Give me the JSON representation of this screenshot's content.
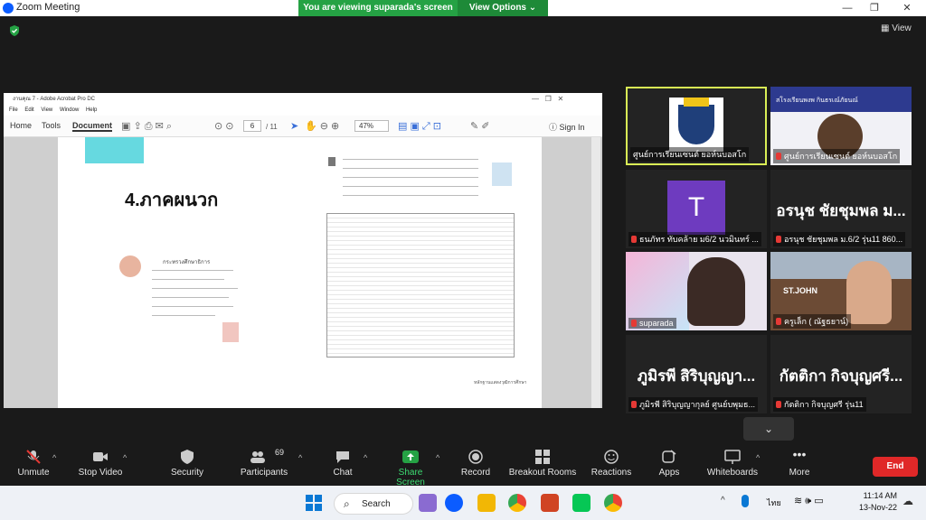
{
  "window": {
    "title": "Zoom Meeting",
    "minimize": "—",
    "maximize": "❐",
    "close": "✕"
  },
  "share_banner": {
    "text": "You are viewing suparada's screen",
    "view_options": "View Options ⌄"
  },
  "view_button": "View",
  "acrobat": {
    "title": "งานคุณ 7 - Adobe Acrobat Pro DC",
    "menu": [
      "File",
      "Edit",
      "View",
      "Window",
      "Help"
    ],
    "tabs": [
      "Home",
      "Tools",
      "Document"
    ],
    "page_current": "6",
    "page_total": "/ 11",
    "zoom": "47%",
    "sign_in": "Sign In",
    "page1_heading": "4.ภาคผนวก",
    "page1_cert_title": "กระทรวงศึกษาธิการ",
    "page2_footer": "หลักฐานแสดงวุฒิการศึกษา"
  },
  "participants": [
    {
      "name": "ศูนย์การเรียนเซนต์ ยอห์นบอสโก",
      "big": "",
      "muted": false
    },
    {
      "name": "ศูนย์การเรียนเซนต์ ยอห์นบอสโก",
      "big": "",
      "muted": true
    },
    {
      "name": "ธนภัทร ทับคล้าย ม6/2 นวมินทร์ ...",
      "big": "T",
      "muted": true
    },
    {
      "name": "อรนุช ชัยชุมพล ม.6/2 รุ่น11 860...",
      "big": "อรนุช ชัยชุมพล ม...",
      "muted": true
    },
    {
      "name": "suparada",
      "big": "",
      "muted": true
    },
    {
      "name": "ครูเล็ก ( ณัฐธยาน์)",
      "big": "",
      "muted": true
    },
    {
      "name": "ภูมิรพี สิริบุญญากุลย์ ศูนย์บพุมธ...",
      "big": "ภูมิรพี สิริบุญญา...",
      "muted": true
    },
    {
      "name": "กัตติกา กิจบุญศรี รุ่น11",
      "big": "กัตติกา กิจบุญศรี...",
      "muted": true
    }
  ],
  "tile_banner_text": "สโรงเรียนพงพ กินธรเณ์ภัยนณ์",
  "tile_stjohn": "ST.JOHN",
  "toolbar": {
    "unmute": "Unmute",
    "stop_video": "Stop Video",
    "security": "Security",
    "participants": "Participants",
    "participants_count": "69",
    "chat": "Chat",
    "share_screen": "Share Screen",
    "record": "Record",
    "breakout_rooms": "Breakout Rooms",
    "reactions": "Reactions",
    "apps": "Apps",
    "whiteboards": "Whiteboards",
    "more": "More",
    "end": "End"
  },
  "taskbar": {
    "search": "Search",
    "lang": "ไทย",
    "time": "11:14 AM",
    "date": "13-Nov-22"
  },
  "colors": {
    "share_green": "#25a244",
    "end_red": "#e02828",
    "highlight_border": "#d9ee55",
    "zoom_blue": "#0b5cff"
  }
}
